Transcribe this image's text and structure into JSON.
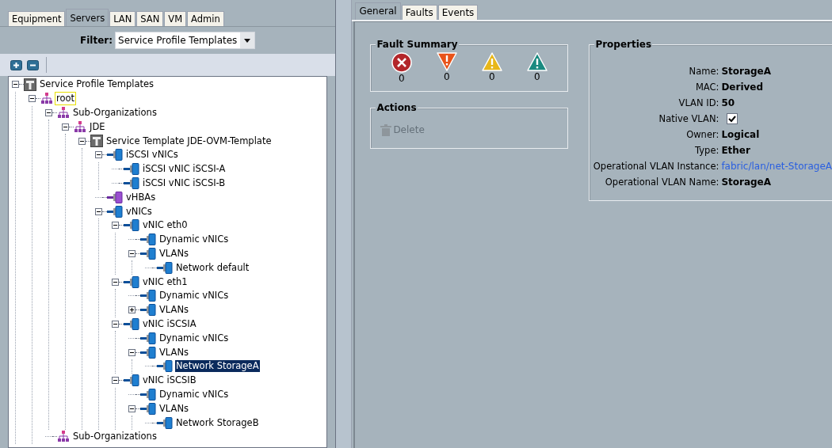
{
  "left_tabs": [
    {
      "label": "Equipment",
      "selected": false
    },
    {
      "label": "Servers",
      "selected": true
    },
    {
      "label": "LAN",
      "selected": false
    },
    {
      "label": "SAN",
      "selected": false
    },
    {
      "label": "VM",
      "selected": false
    },
    {
      "label": "Admin",
      "selected": false
    }
  ],
  "filter": {
    "label": "Filter:",
    "value": "Service Profile Templates"
  },
  "tree": [
    {
      "label": "Service Profile Templates",
      "kind": "template",
      "expanded": true,
      "selected": false,
      "children": [
        {
          "label": "root",
          "kind": "org",
          "expanded": true,
          "selected": false,
          "focused": true,
          "children": [
            {
              "label": "Sub-Organizations",
              "kind": "org",
              "expanded": true,
              "selected": false,
              "children": [
                {
                  "label": "JDE",
                  "kind": "org",
                  "expanded": true,
                  "selected": false,
                  "children": [
                    {
                      "label": "Service Template JDE-OVM-Template",
                      "kind": "template",
                      "expanded": true,
                      "selected": false,
                      "children": [
                        {
                          "label": "iSCSI vNICs",
                          "kind": "nic",
                          "expanded": true,
                          "selected": false,
                          "children": [
                            {
                              "label": "iSCSI vNIC iSCSI-A",
                              "kind": "nic",
                              "selected": false
                            },
                            {
                              "label": "iSCSI vNIC iSCSI-B",
                              "kind": "nic",
                              "selected": false
                            }
                          ]
                        },
                        {
                          "label": "vHBAs",
                          "kind": "hba",
                          "selected": false
                        },
                        {
                          "label": "vNICs",
                          "kind": "nic",
                          "expanded": true,
                          "selected": false,
                          "children": [
                            {
                              "label": "vNIC eth0",
                              "kind": "nic",
                              "expanded": true,
                              "selected": false,
                              "children": [
                                {
                                  "label": "Dynamic vNICs",
                                  "kind": "nic",
                                  "selected": false
                                },
                                {
                                  "label": "VLANs",
                                  "kind": "nic",
                                  "expanded": true,
                                  "selected": false,
                                  "children": [
                                    {
                                      "label": "Network default",
                                      "kind": "nic",
                                      "selected": false
                                    }
                                  ]
                                }
                              ]
                            },
                            {
                              "label": "vNIC eth1",
                              "kind": "nic",
                              "expanded": true,
                              "selected": false,
                              "children": [
                                {
                                  "label": "Dynamic vNICs",
                                  "kind": "nic",
                                  "selected": false
                                },
                                {
                                  "label": "VLANs",
                                  "kind": "nic",
                                  "expanded": false,
                                  "selected": false
                                }
                              ]
                            },
                            {
                              "label": "vNIC iSCSIA",
                              "kind": "nic",
                              "expanded": true,
                              "selected": false,
                              "children": [
                                {
                                  "label": "Dynamic vNICs",
                                  "kind": "nic",
                                  "selected": false
                                },
                                {
                                  "label": "VLANs",
                                  "kind": "nic",
                                  "expanded": true,
                                  "selected": false,
                                  "children": [
                                    {
                                      "label": "Network StorageA",
                                      "kind": "nic",
                                      "selected": true
                                    }
                                  ]
                                }
                              ]
                            },
                            {
                              "label": "vNIC iSCSIB",
                              "kind": "nic",
                              "expanded": true,
                              "selected": false,
                              "children": [
                                {
                                  "label": "Dynamic vNICs",
                                  "kind": "nic",
                                  "selected": false
                                },
                                {
                                  "label": "VLANs",
                                  "kind": "nic",
                                  "expanded": true,
                                  "selected": false,
                                  "children": [
                                    {
                                      "label": "Network StorageB",
                                      "kind": "nic",
                                      "selected": false
                                    }
                                  ]
                                }
                              ]
                            }
                          ]
                        }
                      ]
                    }
                  ]
                }
              ]
            },
            {
              "label": "Sub-Organizations",
              "kind": "org",
              "selected": false
            }
          ]
        }
      ]
    }
  ],
  "right_tabs": [
    {
      "label": "General",
      "selected": true
    },
    {
      "label": "Faults",
      "selected": false
    },
    {
      "label": "Events",
      "selected": false
    }
  ],
  "fault_summary": {
    "title": "Fault Summary",
    "faults": [
      {
        "kind": "critical",
        "count": "0"
      },
      {
        "kind": "major",
        "count": "0"
      },
      {
        "kind": "minor",
        "count": "0"
      },
      {
        "kind": "warning",
        "count": "0"
      }
    ]
  },
  "actions": {
    "title": "Actions",
    "items": [
      {
        "label": "Delete",
        "disabled": true
      }
    ]
  },
  "properties": {
    "title": "Properties",
    "rows": [
      {
        "label": "Name:",
        "kind": "text",
        "value": "StorageA"
      },
      {
        "label": "MAC:",
        "kind": "text",
        "value": "Derived"
      },
      {
        "label": "VLAN ID:",
        "kind": "text",
        "value": "50"
      },
      {
        "label": "Native VLAN:",
        "kind": "checkbox",
        "checked": true
      },
      {
        "label": "Owner:",
        "kind": "text",
        "value": "Logical"
      },
      {
        "label": "Type:",
        "kind": "text",
        "value": "Ether"
      },
      {
        "label": "Operational VLAN Instance:",
        "kind": "link",
        "value": "fabric/lan/net-StorageA"
      },
      {
        "label": "Operational VLAN Name:",
        "kind": "text",
        "value": "StorageA"
      }
    ]
  }
}
